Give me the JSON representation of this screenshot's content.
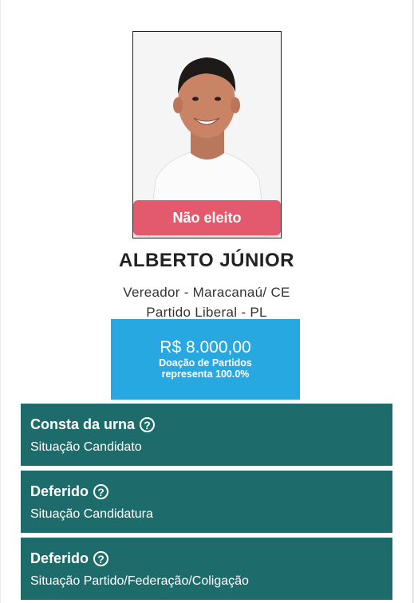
{
  "candidate": {
    "status_label": "Não eleito",
    "name": "ALBERTO JÚNIOR",
    "office": "Vereador - Maracanaú/ CE",
    "party": "Partido Liberal - PL"
  },
  "donation": {
    "amount": "R$ 8.000,00",
    "line1": "Doação de Partidos",
    "line2": "representa 100.0%"
  },
  "info_boxes": [
    {
      "title": "Consta da urna",
      "subtitle": "Situação Candidato",
      "icon": "help-icon"
    },
    {
      "title": "Deferido",
      "subtitle": "Situação Candidatura",
      "icon": "help-icon"
    },
    {
      "title": "Deferido",
      "subtitle": "Situação Partido/Federação/Coligação",
      "icon": "help-icon"
    }
  ],
  "icons": {
    "help": "?"
  },
  "colors": {
    "status_pill": "#e35a6e",
    "donation_bg": "#27a8e0",
    "info_bg": "#1e6b6b"
  }
}
